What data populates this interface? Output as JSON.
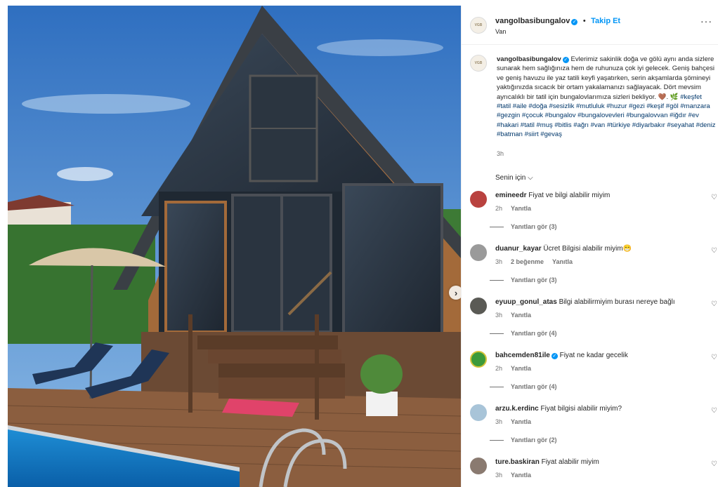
{
  "post": {
    "username": "vangolbasibungalov",
    "verified": true,
    "follow_label": "Takip Et",
    "location": "Van",
    "more_label": "···",
    "avatar_text": "VGB",
    "caption_text": "Evlerimiz sakinlik doğa ve gölü aynı anda sizlere sunarak hem sağlığınıza hem de ruhunuza çok iyi gelecek. Geniş bahçesi ve geniş havuzu ile yaz tatili keyfi yaşatırken, serin akşamlarda şömineyi yaktığınızda sıcacık bir ortam yakalamanızı sağlayacak. Dört mevsim ayrıcalıklı bir tatil için bungalovlarımıza sizleri bekliyor. 🤎. 🌿",
    "hashtags": "#keşfet #tatil #aile #doğa #sesizlik #mutluluk #huzur #gezi #keşif #göl #manzara #gezgin #çocuk #bungalov #bungalovevleri #bungalovvan #iğdır #ev #hakari #tatil #muş #bitlis #ağrı #van #türkiye #diyarbakır #seyahat #deniz #batman #siirt #gevaş",
    "time": "3h",
    "sort_label": "Senin için ⌵"
  },
  "comments": [
    {
      "user": "emineedr",
      "text": "Fiyat ve bilgi alabilir miyim",
      "time": "2h",
      "likes": "",
      "reply": "Yanıtla",
      "view_replies": "Yanıtları gör (3)",
      "avatar_color": "#b9423f"
    },
    {
      "user": "duanur_kayar",
      "text": "Ücret Bilgisi alabilir miyim😁",
      "time": "3h",
      "likes": "2 beğenme",
      "reply": "Yanıtla",
      "view_replies": "Yanıtları gör (3)",
      "avatar_color": "#9a9a9a"
    },
    {
      "user": "eyuup_gonul_atas",
      "text": "Bilgi alabilirmiyim burası nereye bağlı",
      "time": "3h",
      "likes": "",
      "reply": "Yanıtla",
      "view_replies": "Yanıtları gör (4)",
      "avatar_color": "#5a5a55"
    },
    {
      "user": "bahcemden81ile",
      "text": "Fiyat ne kadar gecelik",
      "time": "2h",
      "likes": "",
      "reply": "Yanıtla",
      "view_replies": "Yanıtları gör (4)",
      "avatar_color": "#3c9a3a",
      "verified": true
    },
    {
      "user": "arzu.k.erdinc",
      "text": "Fiyat bilgisi alabilir miyim?",
      "time": "3h",
      "likes": "",
      "reply": "Yanıtla",
      "view_replies": "Yanıtları gör (2)",
      "avatar_color": "#a8c4d8"
    },
    {
      "user": "ture.baskiran",
      "text": "Fiyat alabilir miyim",
      "time": "3h",
      "likes": "",
      "reply": "Yanıtla",
      "view_replies": "",
      "avatar_color": "#8a7a70"
    }
  ],
  "colors": {
    "accent": "#0095f6",
    "hashtag": "#00376b",
    "muted": "#737373"
  },
  "icons": {
    "heart": "heart-icon",
    "next": "chevron-right-icon",
    "more": "more-icon"
  }
}
